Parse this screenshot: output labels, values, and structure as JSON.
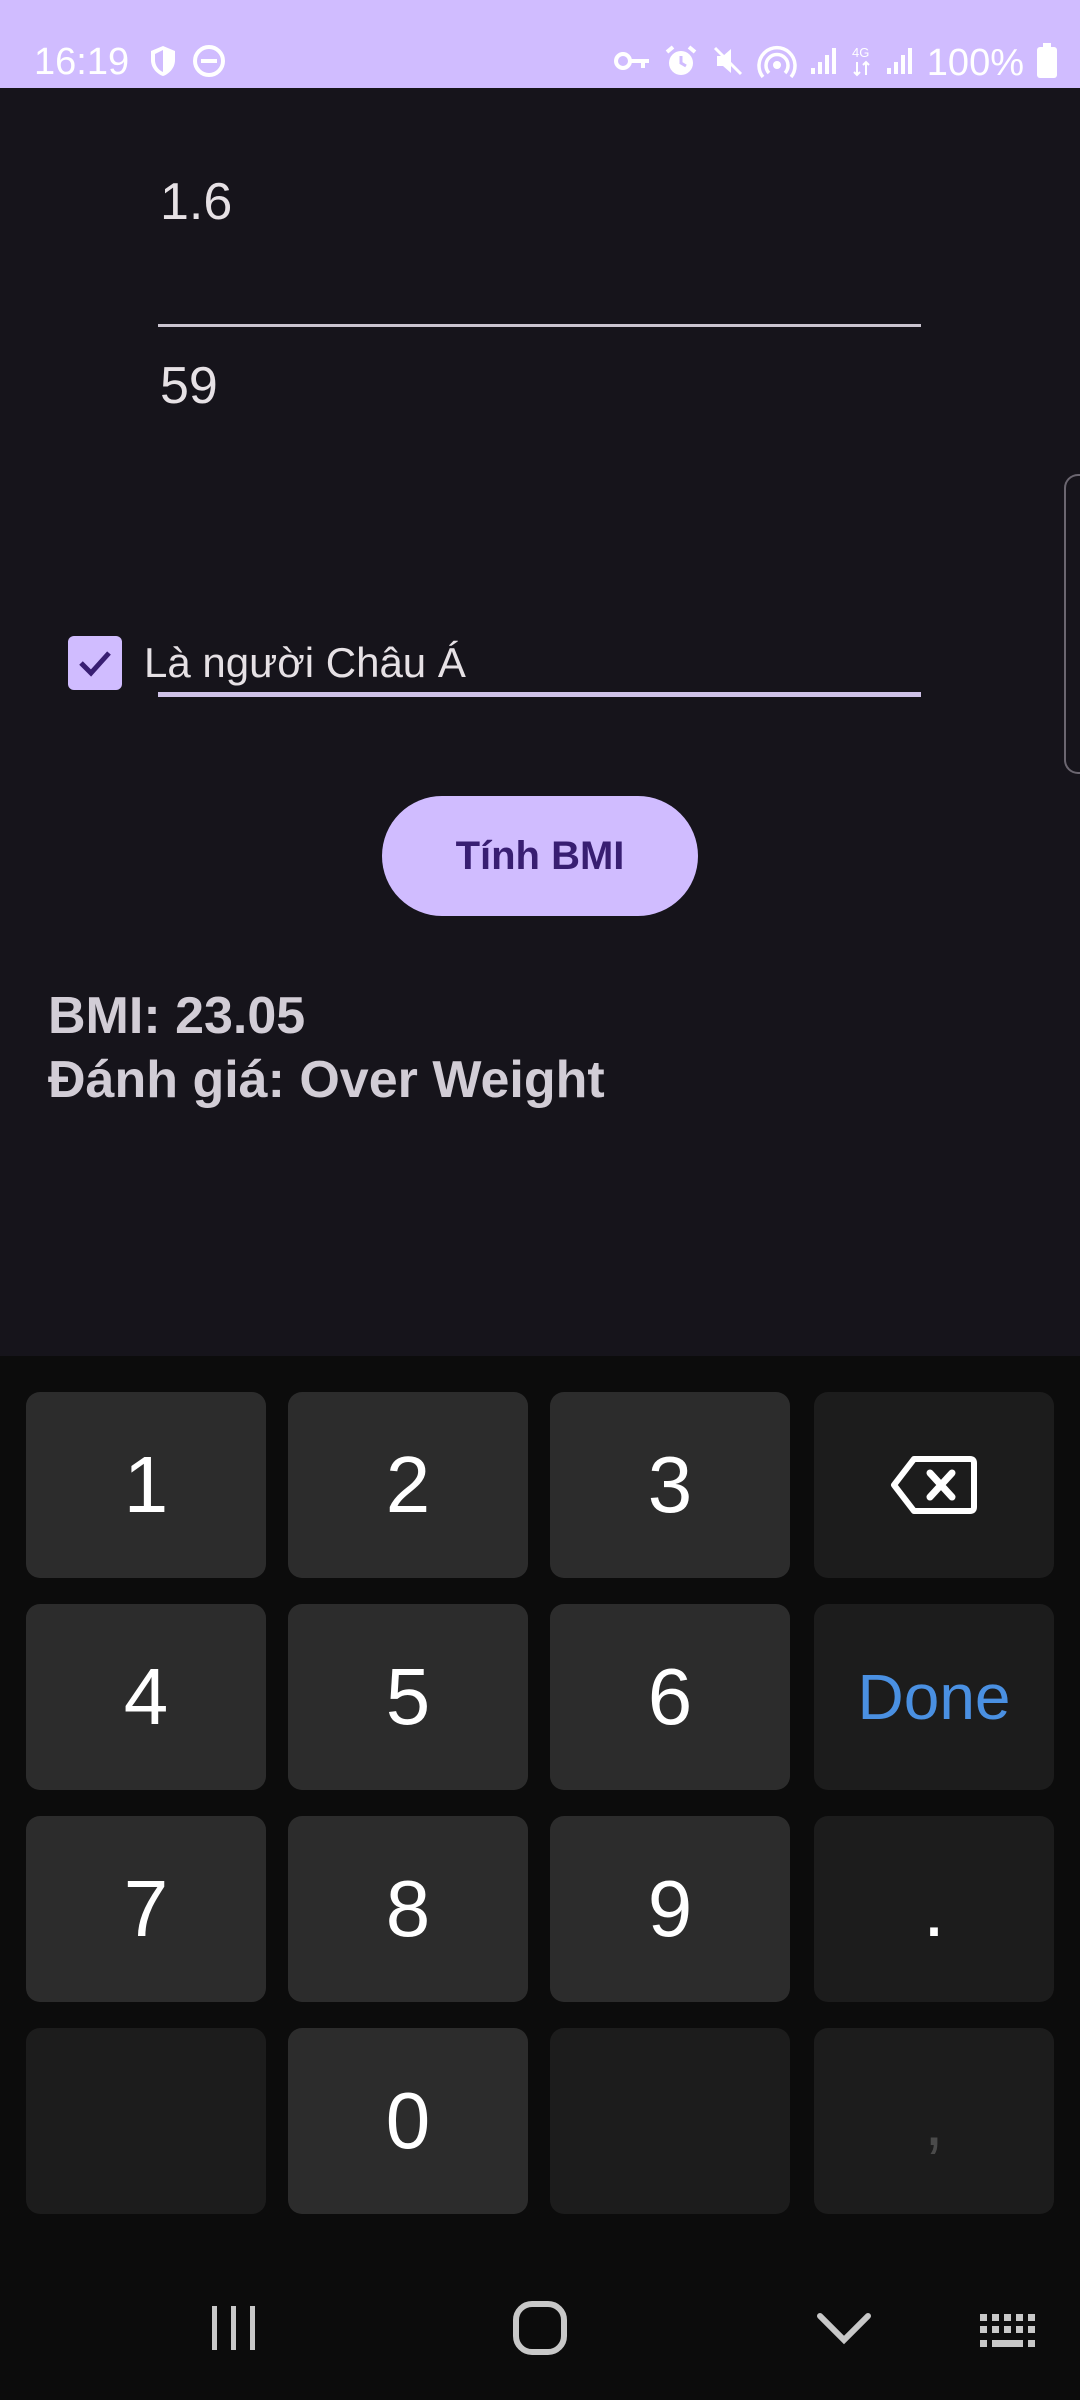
{
  "status_bar": {
    "time": "16:19",
    "battery": "100%",
    "left_icons": [
      "shield-icon",
      "do-not-disturb-icon"
    ],
    "right_icons": [
      "vpn-key-icon",
      "alarm-icon",
      "mute-icon",
      "hotspot-icon",
      "signal-icon",
      "4g-icon",
      "signal-icon",
      "battery-icon"
    ]
  },
  "form": {
    "height_value": "1.6",
    "weight_value": "59",
    "asian_checkbox_label": "Là người Châu Á",
    "asian_checked": true,
    "calculate_button": "Tính BMI"
  },
  "result": {
    "bmi_line": "BMI: 23.05",
    "rating_line": "Đánh giá: Over Weight"
  },
  "keyboard": {
    "keys": {
      "k1": "1",
      "k2": "2",
      "k3": "3",
      "k4": "4",
      "k5": "5",
      "k6": "6",
      "k7": "7",
      "k8": "8",
      "k9": "9",
      "k0": "0",
      "done": "Done",
      "dot": ".",
      "comma": ","
    }
  },
  "colors": {
    "accent": "#d0bcff",
    "background": "#16141b",
    "done_key": "#4a90e2"
  }
}
